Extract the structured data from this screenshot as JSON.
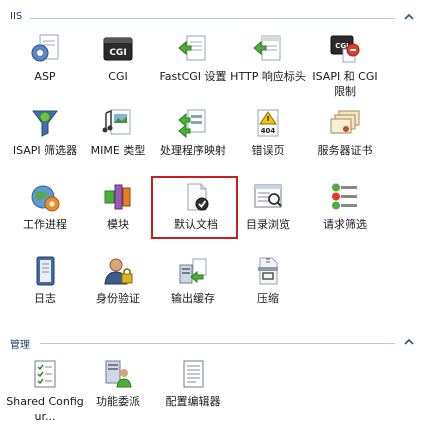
{
  "sections": {
    "iis": {
      "title": "IIS",
      "items": [
        {
          "label": "ASP",
          "icon": "asp-icon"
        },
        {
          "label": "CGI",
          "icon": "cgi-icon"
        },
        {
          "label": "FastCGI 设置",
          "icon": "fastcgi-settings-icon"
        },
        {
          "label": "HTTP 响应标头",
          "icon": "http-response-headers-icon"
        },
        {
          "label": "ISAPI 和 CGI 限制",
          "icon": "isapi-cgi-restrictions-icon"
        },
        {
          "label": "ISAPI 筛选器",
          "icon": "isapi-filters-icon"
        },
        {
          "label": "MIME 类型",
          "icon": "mime-types-icon"
        },
        {
          "label": "处理程序映射",
          "icon": "handler-mappings-icon"
        },
        {
          "label": "错误页",
          "icon": "error-pages-icon"
        },
        {
          "label": "服务器证书",
          "icon": "server-certificates-icon"
        },
        {
          "label": "工作进程",
          "icon": "worker-processes-icon"
        },
        {
          "label": "模块",
          "icon": "modules-icon"
        },
        {
          "label": "默认文档",
          "icon": "default-document-icon"
        },
        {
          "label": "目录浏览",
          "icon": "directory-browsing-icon"
        },
        {
          "label": "请求筛选",
          "icon": "request-filtering-icon"
        },
        {
          "label": "日志",
          "icon": "logging-icon"
        },
        {
          "label": "身份验证",
          "icon": "authentication-icon"
        },
        {
          "label": "输出缓存",
          "icon": "output-caching-icon"
        },
        {
          "label": "压缩",
          "icon": "compression-icon"
        }
      ]
    },
    "management": {
      "title": "管理",
      "items": [
        {
          "label": "Shared Configur...",
          "icon": "shared-configuration-icon"
        },
        {
          "label": "功能委派",
          "icon": "feature-delegation-icon"
        },
        {
          "label": "配置编辑器",
          "icon": "configuration-editor-icon"
        }
      ]
    }
  },
  "selected_item": "默认文档",
  "colors": {
    "section_title": "#1e3a6e",
    "section_line": "#b9c6db",
    "selection_border": "#c82020"
  }
}
